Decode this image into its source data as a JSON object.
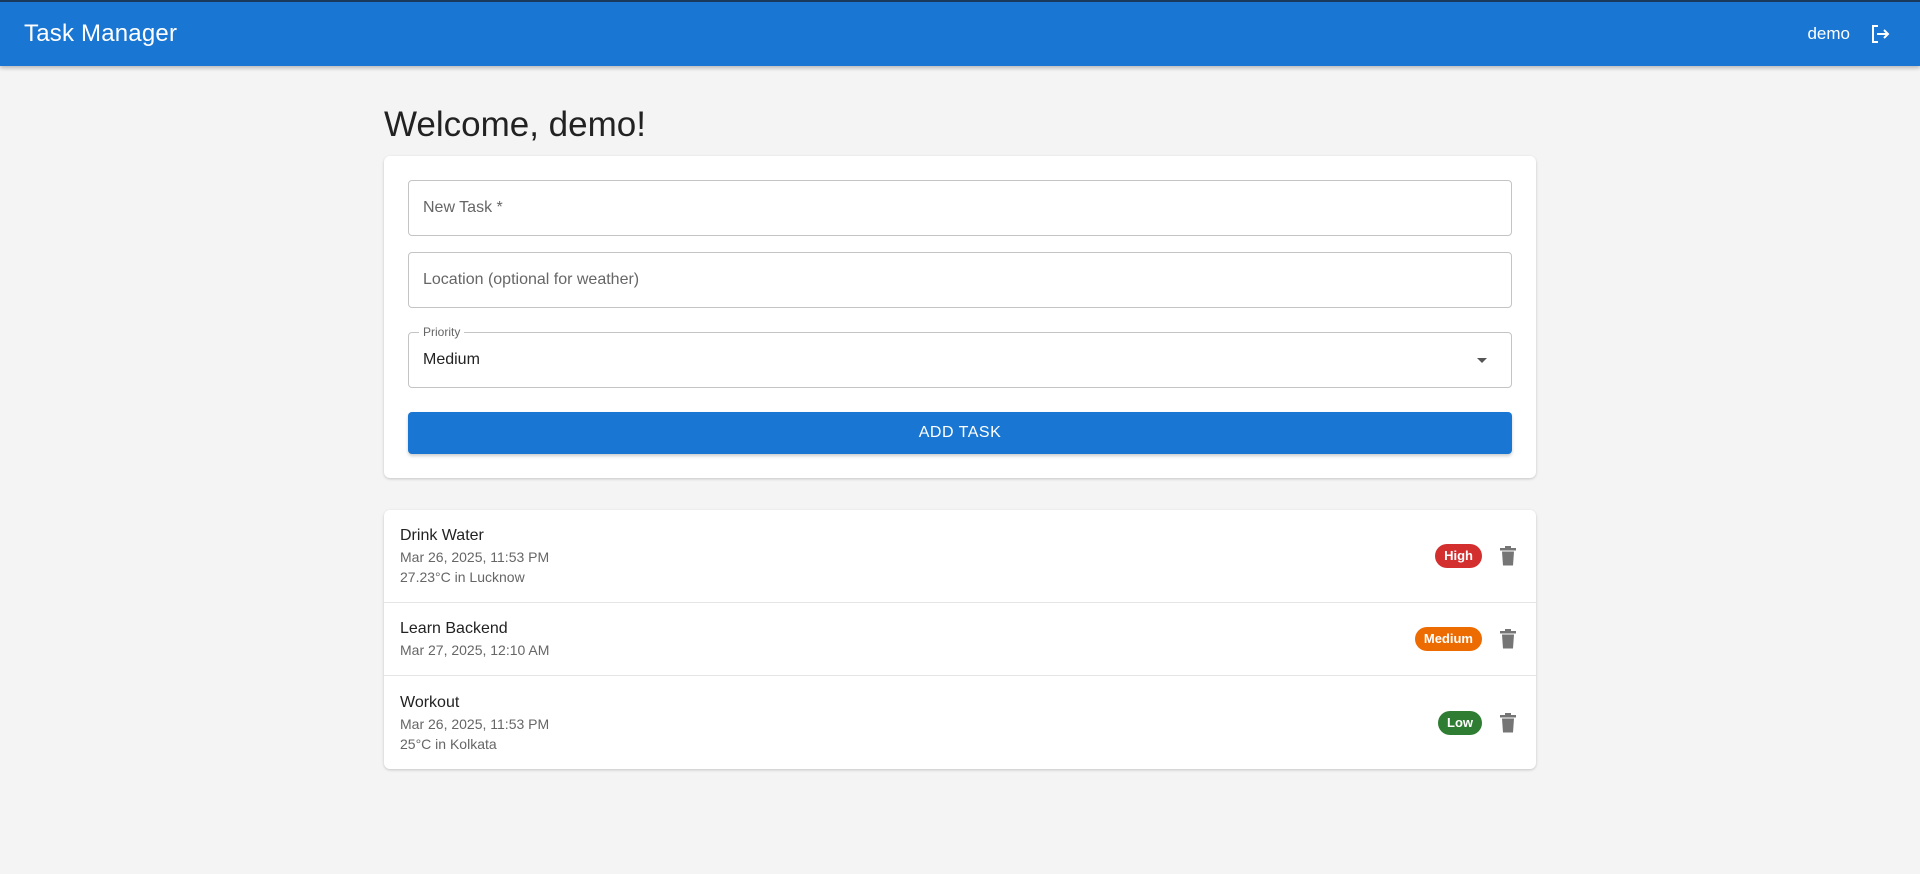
{
  "header": {
    "app_title": "Task Manager",
    "username": "demo"
  },
  "welcome": "Welcome, demo!",
  "form": {
    "task_placeholder": "New Task *",
    "location_placeholder": "Location (optional for weather)",
    "priority_label": "Priority",
    "priority_value": "Medium",
    "add_button": "ADD TASK"
  },
  "tasks": [
    {
      "title": "Drink Water",
      "datetime": "Mar 26, 2025, 11:53 PM",
      "weather": "27.23°C in Lucknow",
      "priority": "High",
      "priority_color": "#d32f2f"
    },
    {
      "title": "Learn Backend",
      "datetime": "Mar 27, 2025, 12:10 AM",
      "weather": "",
      "priority": "Medium",
      "priority_color": "#ed6c02"
    },
    {
      "title": "Workout",
      "datetime": "Mar 26, 2025, 11:53 PM",
      "weather": "25°C in Kolkata",
      "priority": "Low",
      "priority_color": "#2e7d32"
    }
  ],
  "colors": {
    "primary": "#1976d2",
    "background": "#f4f4f4"
  },
  "icons": {
    "logout": "logout-icon",
    "delete": "trash-icon",
    "dropdown": "caret-down-icon"
  }
}
